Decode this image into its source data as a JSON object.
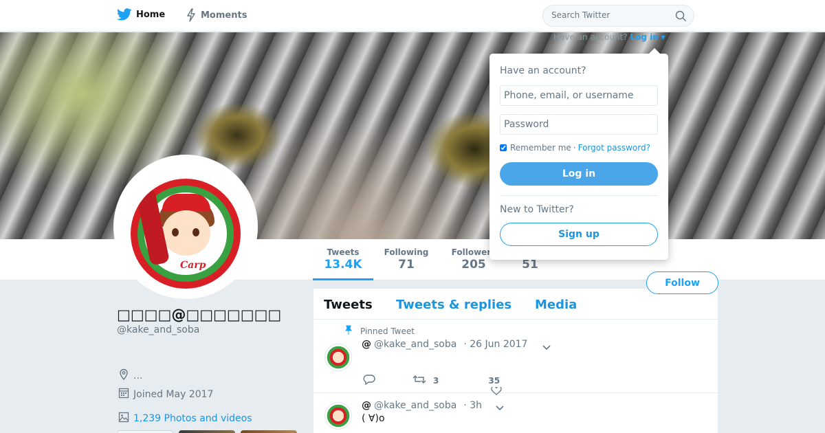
{
  "nav": {
    "home_label": "Home",
    "moments_label": "Moments",
    "search_placeholder": "Search Twitter"
  },
  "banner": {
    "have_account_text": "Have an account?",
    "login_link": "Log in"
  },
  "profile": {
    "name": "□□□□@□□□□□□□",
    "handle": "@kake_and_soba",
    "location": "...",
    "joined": "Joined May 2017",
    "photos_videos": "1,239 Photos and videos",
    "follow_label": "Follow",
    "avatar_text": "Carp"
  },
  "stats": [
    {
      "label": "Tweets",
      "value": "13.4K"
    },
    {
      "label": "Following",
      "value": "71"
    },
    {
      "label": "Followers",
      "value": "205"
    },
    {
      "label": "",
      "value": "51"
    }
  ],
  "timeline": {
    "tabs": [
      "Tweets",
      "Tweets & replies",
      "Media"
    ],
    "tweets": [
      {
        "pinned_label": "Pinned Tweet",
        "at": "@",
        "handle": "@kake_and_soba",
        "time": "· 26 Jun 2017",
        "text": "",
        "retweets": "3",
        "likes": "35"
      },
      {
        "at": "@",
        "handle": "@kake_and_soba",
        "time": "· 3h",
        "text": "( ∀)o"
      }
    ]
  },
  "login_dropdown": {
    "title": "Have an account?",
    "username_placeholder": "Phone, email, or username",
    "password_placeholder": "Password",
    "remember_label": "Remember me",
    "separator": "·",
    "forgot_label": "Forgot password?",
    "login_button": "Log in",
    "new_label": "New to Twitter?",
    "signup_button": "Sign up"
  },
  "colors": {
    "accent": "#1da1f2",
    "link": "#1b95e0",
    "background": "#e6ecf0",
    "carp_red": "#d81f26",
    "carp_green": "#3aa142"
  }
}
